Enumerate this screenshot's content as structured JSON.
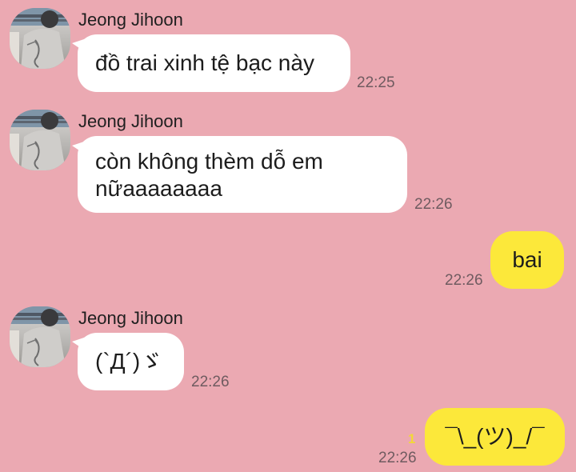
{
  "colors": {
    "background": "#eba9b2",
    "incoming_bubble": "#ffffff",
    "outgoing_bubble": "#fce83a",
    "unread_badge": "#f2d836"
  },
  "messages": [
    {
      "direction": "in",
      "sender": "Jeong Jihoon",
      "text": "đồ trai xinh tệ bạc này",
      "time": "22:25"
    },
    {
      "direction": "in",
      "sender": "Jeong Jihoon",
      "text": "còn không thèm dỗ em nữaaaaaaaa",
      "time": "22:26"
    },
    {
      "direction": "out",
      "text": "bai",
      "time": "22:26"
    },
    {
      "direction": "in",
      "sender": "Jeong Jihoon",
      "text": "(`Д´)ゞ",
      "time": "22:26"
    },
    {
      "direction": "out",
      "text": "¯\\_(ツ)_/¯",
      "time": "22:26",
      "unread_count": "1"
    }
  ]
}
